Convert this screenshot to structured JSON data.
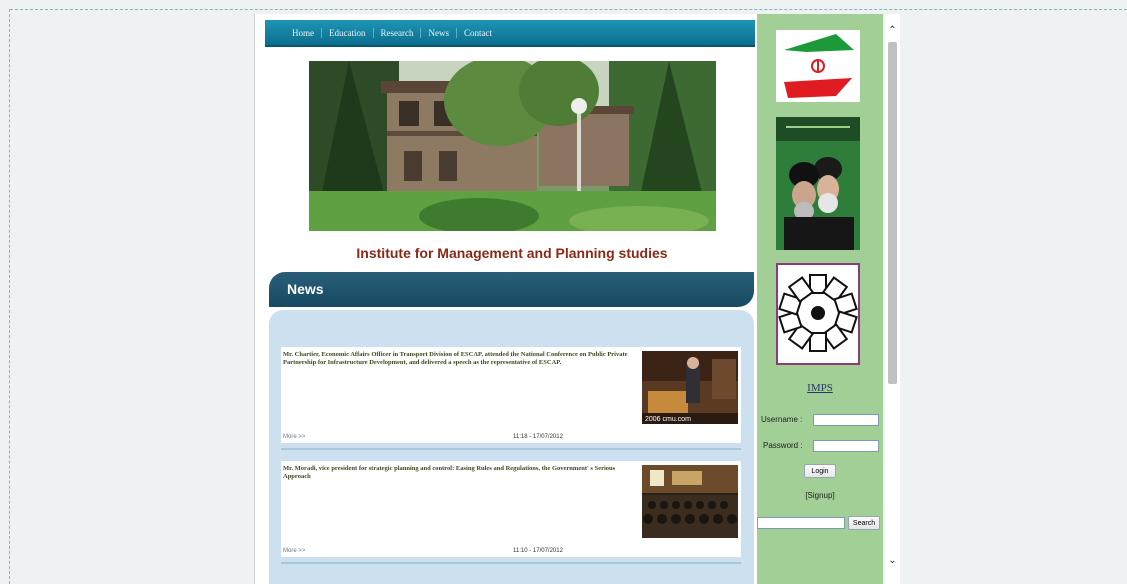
{
  "nav": {
    "items": [
      "Home",
      "Education",
      "Research",
      "News",
      "Contact"
    ]
  },
  "site": {
    "title": "Institute for Management and Planning studies"
  },
  "news": {
    "heading": "News",
    "items": [
      {
        "text": "Mr. Chartier, Economic Affairs Officer in Transport Division of ESCAP, attended the National Conference on Public Private Partnership for Infrastructure Development, and delivered a speech as the representative of ESCAP.",
        "more": "More >>",
        "date": "11:18 - 17/07/2012",
        "thumb_caption": "2006 cmu.com"
      },
      {
        "text": "Mr. Moradi, vice president for strategic planning and control: Easing Rules and Regulations, the Government' s Serious Approach",
        "more": "More >>",
        "date": "11:10 - 17/07/2012"
      }
    ]
  },
  "sidebar": {
    "imps_link": "IMPS",
    "username_label": "Username :",
    "password_label": "Password :",
    "username_value": "",
    "password_value": "",
    "login_label": "Login",
    "signup_label": "[Signup]",
    "search_placeholder": "",
    "search_label": "Search"
  },
  "colors": {
    "nav": "#0b6e8f",
    "title": "#8a2a16",
    "sidebar": "#a2cf96",
    "news_header": "#1f5670"
  }
}
